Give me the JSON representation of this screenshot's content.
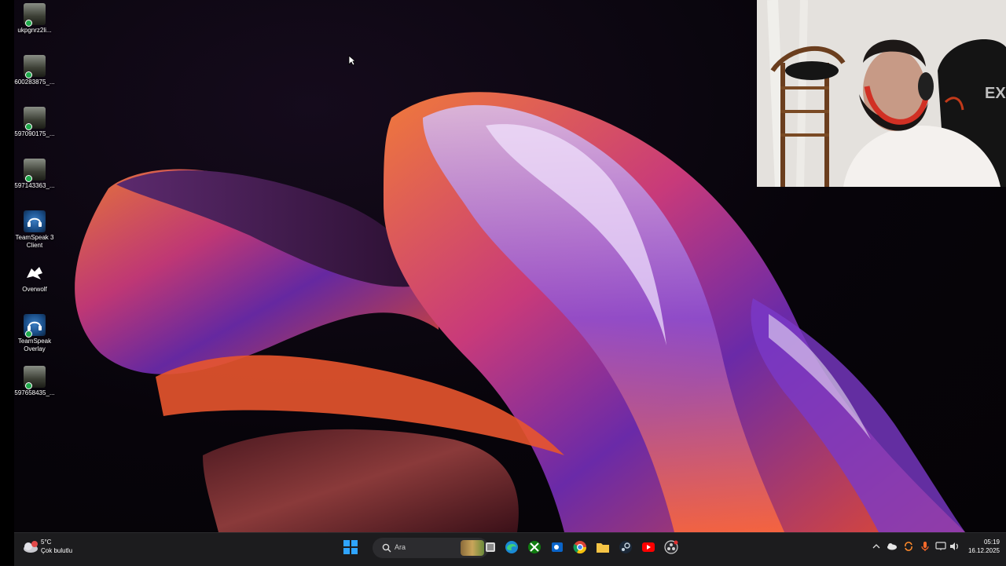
{
  "desktop": {
    "icons": [
      {
        "label": "ukpgnrz2li...",
        "icon": "photo-thumbnail-icon"
      },
      {
        "label": "600283875_...",
        "icon": "photo-thumbnail-icon"
      },
      {
        "label": "597090175_...",
        "icon": "photo-thumbnail-icon"
      },
      {
        "label": "597143363_...",
        "icon": "photo-thumbnail-icon"
      },
      {
        "label": "TeamSpeak 3 Client",
        "icon": "teamspeak-icon"
      },
      {
        "label": "Overwolf",
        "icon": "overwolf-icon"
      },
      {
        "label": "TeamSpeak Overlay",
        "icon": "teamspeak-overlay-icon"
      },
      {
        "label": "597658435_...",
        "icon": "photo-thumbnail-icon"
      }
    ]
  },
  "taskbar": {
    "weather": {
      "temp": "5°C",
      "condition": "Çok bulutlu",
      "icon": "cloudy-weather-icon"
    },
    "search_placeholder": "Ara",
    "pinned": [
      "start-icon",
      "search-icon",
      "task-view-icon",
      "edge-icon",
      "xbox-icon",
      "outlook-icon",
      "chrome-icon",
      "file-explorer-icon",
      "steam-icon",
      "youtube-icon",
      "obs-icon"
    ],
    "tray": [
      "chevron-up-icon",
      "onedrive-icon",
      "sync-icon",
      "microphone-icon",
      "display-icon",
      "volume-icon"
    ],
    "time": "05:19",
    "date": "16.12.2025"
  },
  "colors": {
    "taskbar_bg": "#1c1c1e",
    "desktop_bg": "#07040a",
    "accent": "#0a7ad8"
  }
}
